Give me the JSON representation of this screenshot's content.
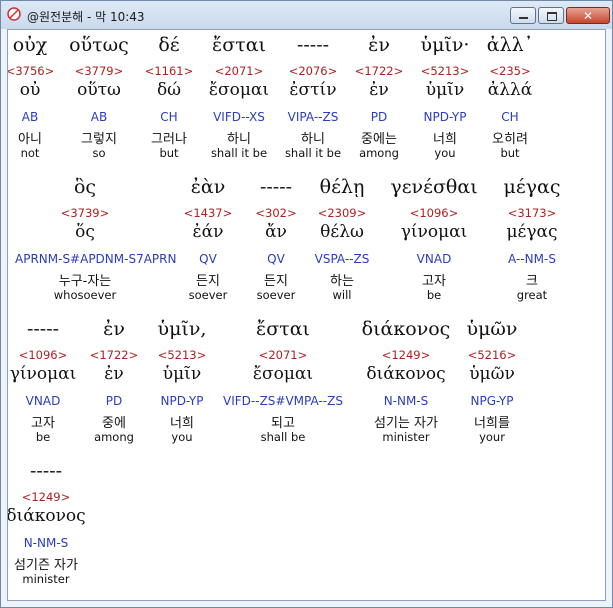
{
  "window": {
    "title": "@원전분해 - 막 10:43",
    "buttons": {
      "minimize": "▬",
      "maximize": "▭",
      "close": "✕"
    }
  },
  "rows": [
    [
      {
        "gk": "οὐχ",
        "sn": "<3756>",
        "lem": "οὐ",
        "mo": "AB",
        "ko": "아니",
        "en": "not"
      },
      {
        "gk": "οὕτως",
        "sn": "<3779>",
        "lem": "οὕτω",
        "mo": "AB",
        "ko": "그렇지",
        "en": "so"
      },
      {
        "gk": "δέ",
        "sn": "<1161>",
        "lem": "δώ",
        "mo": "CH",
        "ko": "그러나",
        "en": "but"
      },
      {
        "gk": "ἔσται",
        "sn": "<2071>",
        "lem": "ἔσομαι",
        "mo": "VIFD--XS",
        "ko": "하니",
        "en": "shall it be"
      },
      {
        "gk": "-----",
        "sn": "<2076>",
        "lem": "ἐστίν",
        "mo": "VIPA--ZS",
        "ko": "하니",
        "en": "shall it be"
      },
      {
        "gk": "ἐν",
        "sn": "<1722>",
        "lem": "ἐν",
        "mo": "PD",
        "ko": "중에는",
        "en": "among"
      },
      {
        "gk": "ὑμῖν·",
        "sn": "<5213>",
        "lem": "ὑμῖν",
        "mo": "NPD-YP",
        "ko": "너희",
        "en": "you"
      },
      {
        "gk": "ἀλλ᾽",
        "sn": "<235>",
        "lem": "ἀλλά",
        "mo": "CH",
        "ko": "오히려",
        "en": "but"
      }
    ],
    [
      {
        "gk": "ὃς",
        "sn": "<3739>",
        "lem": "ὅς",
        "mo": "APRNM-S#APDNM-S7APRN",
        "ko": "누구-자는",
        "en": "whosoever"
      },
      {
        "gk": "ἐὰν",
        "sn": "<1437>",
        "lem": "ἐάν",
        "mo": "QV",
        "ko": "든지",
        "en": "soever"
      },
      {
        "gk": "-----",
        "sn": "<302>",
        "lem": "ἄν",
        "mo": "QV",
        "ko": "든지",
        "en": "soever"
      },
      {
        "gk": "θέλῃ",
        "sn": "<2309>",
        "lem": "θέλω",
        "mo": "VSPA--ZS",
        "ko": "하는",
        "en": "will"
      },
      {
        "gk": "γενέσθαι",
        "sn": "<1096>",
        "lem": "γίνομαι",
        "mo": "VNAD",
        "ko": "고자",
        "en": "be"
      },
      {
        "gk": "μέγας",
        "sn": "<3173>",
        "lem": "μέγας",
        "mo": "A--NM-S",
        "ko": "크",
        "en": "great"
      }
    ],
    [
      {
        "gk": "-----",
        "sn": "<1096>",
        "lem": "γίνομαι",
        "mo": "VNAD",
        "ko": "고자",
        "en": "be"
      },
      {
        "gk": "ἐν",
        "sn": "<1722>",
        "lem": "ἐν",
        "mo": "PD",
        "ko": "중에",
        "en": "among"
      },
      {
        "gk": "ὑμῖν,",
        "sn": "<5213>",
        "lem": "ὑμῖν",
        "mo": "NPD-YP",
        "ko": "너희",
        "en": "you"
      },
      {
        "gk": "ἔσται",
        "sn": "<2071>",
        "lem": "ἔσομαι",
        "mo": "VIFD--ZS#VMPA--ZS",
        "ko": "되고",
        "en": "shall be"
      },
      {
        "gk": "διάκονος",
        "sn": "<1249>",
        "lem": "διάκονος",
        "mo": "N-NM-S",
        "ko": "섬기는 자가",
        "en": "minister"
      },
      {
        "gk": "ὑμῶν",
        "sn": "<5216>",
        "lem": "ὑμῶν",
        "mo": "NPG-YP",
        "ko": "너희를",
        "en": "your"
      }
    ],
    [
      {
        "gk": "-----",
        "sn": "<1249>",
        "lem": "διάκονος",
        "mo": "N-NM-S",
        "ko": "섬기즌 자가",
        "en": "minister"
      }
    ]
  ]
}
